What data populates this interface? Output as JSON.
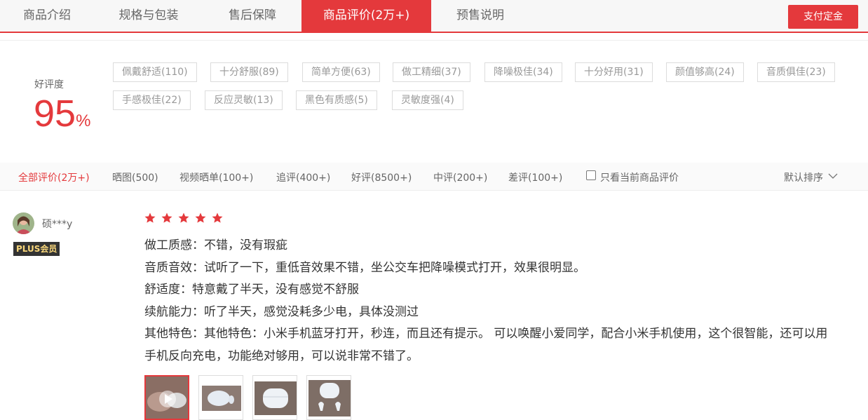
{
  "tabs": [
    {
      "label": "商品介绍"
    },
    {
      "label": "规格与包装"
    },
    {
      "label": "售后保障"
    },
    {
      "label": "商品评价(2万+)"
    },
    {
      "label": "预售说明"
    }
  ],
  "pay_button": "支付定金",
  "summary": {
    "label": "好评度",
    "value": "95",
    "unit": "%"
  },
  "tags": [
    "佩戴舒适(110)",
    "十分舒服(89)",
    "简单方便(63)",
    "做工精细(37)",
    "降噪极佳(34)",
    "十分好用(31)",
    "颜值够高(24)",
    "音质俱佳(23)",
    "手感极佳(22)",
    "反应灵敏(13)",
    "黑色有质感(5)",
    "灵敏度强(4)"
  ],
  "filters": [
    "全部评价(2万+)",
    "晒图(500)",
    "视频晒单(100+)",
    "追评(400+)",
    "好评(8500+)",
    "中评(200+)",
    "差评(100+)"
  ],
  "only_current_label": "只看当前商品评价",
  "sort_label": "默认排序",
  "review": {
    "user": "硕***y",
    "badge": "PLUS会员",
    "stars": 5,
    "lines": [
      "做工质感：不错，没有瑕疵",
      "音质音效：试听了一下，重低音效果不错，坐公交车把降噪模式打开，效果很明显。",
      "舒适度：特意戴了半天，没有感觉不舒服",
      "续航能力：听了半天，感觉没耗多少电，具体没测过",
      "其他特色：其他特色：小米手机蓝牙打开，秒连，而且还有提示。 可以唤醒小爱同学，配合小米手机使用，这个很智能，还可以用",
      "手机反向充电，功能绝对够用，可以说非常不错了。"
    ]
  },
  "colors": {
    "accent": "#e4393c",
    "badge_bg": "#333333",
    "badge_text": "#f8d67a"
  }
}
